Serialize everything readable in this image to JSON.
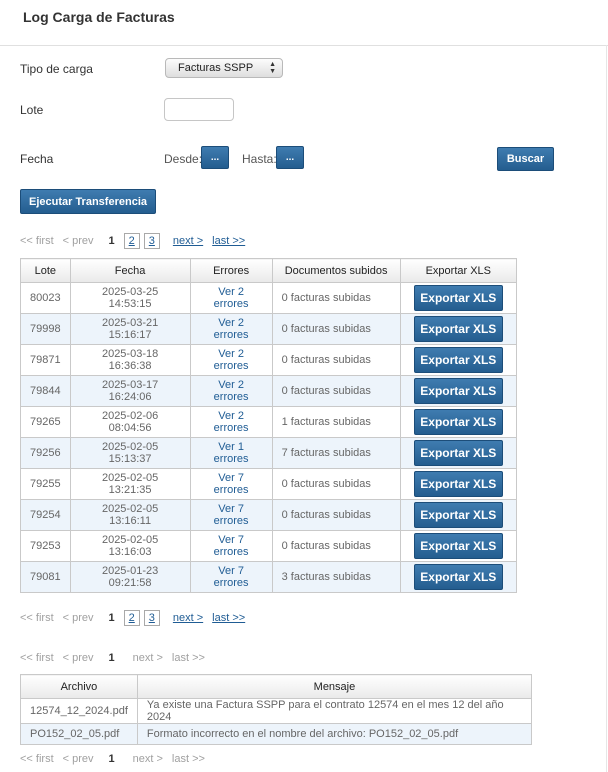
{
  "page_title": "Log Carga de Facturas",
  "form": {
    "tipo_label": "Tipo de carga",
    "tipo_value": "Facturas SSPP",
    "lote_label": "Lote",
    "fecha_label": "Fecha",
    "desde_label": "Desde:",
    "hasta_label": "Hasta:",
    "dots": "...",
    "buscar_label": "Buscar",
    "ejecutar_label": "Ejecutar Transferencia"
  },
  "pager_main": {
    "first": "<< first",
    "prev": "< prev",
    "pages": [
      "1",
      "2",
      "3"
    ],
    "next": "next >",
    "last": "last >>"
  },
  "main_table": {
    "headers": [
      "Lote",
      "Fecha",
      "Errores",
      "Documentos subidos",
      "Exportar XLS"
    ],
    "button_label": "Exportar XLS",
    "rows": [
      {
        "lote": "80023",
        "fecha": "2025-03-25 14:53:15",
        "errores": "Ver 2 errores",
        "docs": "0 facturas subidas"
      },
      {
        "lote": "79998",
        "fecha": "2025-03-21 15:16:17",
        "errores": "Ver 2 errores",
        "docs": "0 facturas subidas"
      },
      {
        "lote": "79871",
        "fecha": "2025-03-18 16:36:38",
        "errores": "Ver 2 errores",
        "docs": "0 facturas subidas"
      },
      {
        "lote": "79844",
        "fecha": "2025-03-17 16:24:06",
        "errores": "Ver 2 errores",
        "docs": "0 facturas subidas"
      },
      {
        "lote": "79265",
        "fecha": "2025-02-06 08:04:56",
        "errores": "Ver 2 errores",
        "docs": "1 facturas subidas"
      },
      {
        "lote": "79256",
        "fecha": "2025-02-05 15:13:37",
        "errores": "Ver 1 errores",
        "docs": "7 facturas subidas"
      },
      {
        "lote": "79255",
        "fecha": "2025-02-05 13:21:35",
        "errores": "Ver 7 errores",
        "docs": "0 facturas subidas"
      },
      {
        "lote": "79254",
        "fecha": "2025-02-05 13:16:11",
        "errores": "Ver 7 errores",
        "docs": "0 facturas subidas"
      },
      {
        "lote": "79253",
        "fecha": "2025-02-05 13:16:03",
        "errores": "Ver 7 errores",
        "docs": "0 facturas subidas"
      },
      {
        "lote": "79081",
        "fecha": "2025-01-23 09:21:58",
        "errores": "Ver 7 errores",
        "docs": "3 facturas subidas"
      }
    ]
  },
  "pager_msg": {
    "first": "<< first",
    "prev": "< prev",
    "page": "1",
    "next": "next >",
    "last": "last >>"
  },
  "msg_table": {
    "headers": [
      "Archivo",
      "Mensaje"
    ],
    "rows": [
      {
        "archivo": "12574_12_2024.pdf",
        "mensaje": "Ya existe una Factura SSPP para el contrato 12574 en el mes 12 del año 2024"
      },
      {
        "archivo": "PO152_02_05.pdf",
        "mensaje": "Formato incorrecto en el nombre del archivo: PO152_02_05.pdf"
      }
    ]
  }
}
